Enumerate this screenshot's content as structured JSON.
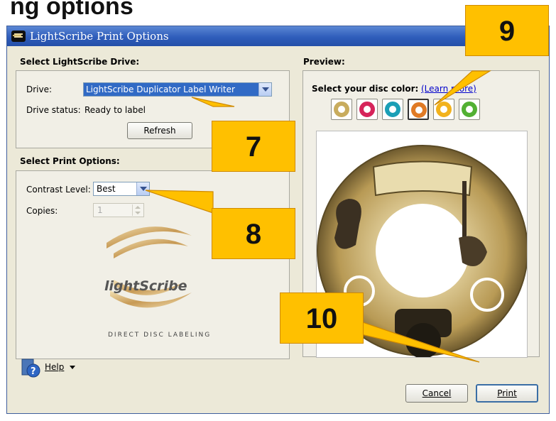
{
  "top_heading": "ng options",
  "window": {
    "title": "LightScribe Print Options"
  },
  "drive_section": {
    "heading": "Select LightScribe Drive:",
    "drive_label": "Drive:",
    "drive_value": "LightScribe Duplicator Label Writer",
    "status_label": "Drive status:",
    "status_value": "Ready to label",
    "refresh_label": "Refresh"
  },
  "print_options": {
    "heading": "Select Print Options:",
    "contrast_label": "Contrast Level:",
    "contrast_value": "Best",
    "copies_label": "Copies:",
    "copies_value": "1"
  },
  "branding": {
    "logo_text": "lightScribe",
    "tagline": "DIRECT DISC LABELING"
  },
  "preview": {
    "heading": "Preview:",
    "disc_color_label": "Select your disc color:",
    "learn_more": "(Learn more)",
    "swatches": [
      {
        "name": "gold",
        "color": "#c8ac5e"
      },
      {
        "name": "magenta",
        "color": "#d6245a"
      },
      {
        "name": "teal",
        "color": "#1b9fb6"
      },
      {
        "name": "orange",
        "color": "#e07a25",
        "selected": true
      },
      {
        "name": "yellow",
        "color": "#f2b21c"
      },
      {
        "name": "green",
        "color": "#52b033"
      }
    ]
  },
  "footer": {
    "help_label": "Help",
    "cancel_label": "Cancel",
    "print_label": "Print"
  },
  "callouts": {
    "c7": "7",
    "c8": "8",
    "c9": "9",
    "c10": "10"
  },
  "colors": {
    "accent": "#316ac5",
    "callout": "#ffc000",
    "disc": "#c9b27a"
  }
}
